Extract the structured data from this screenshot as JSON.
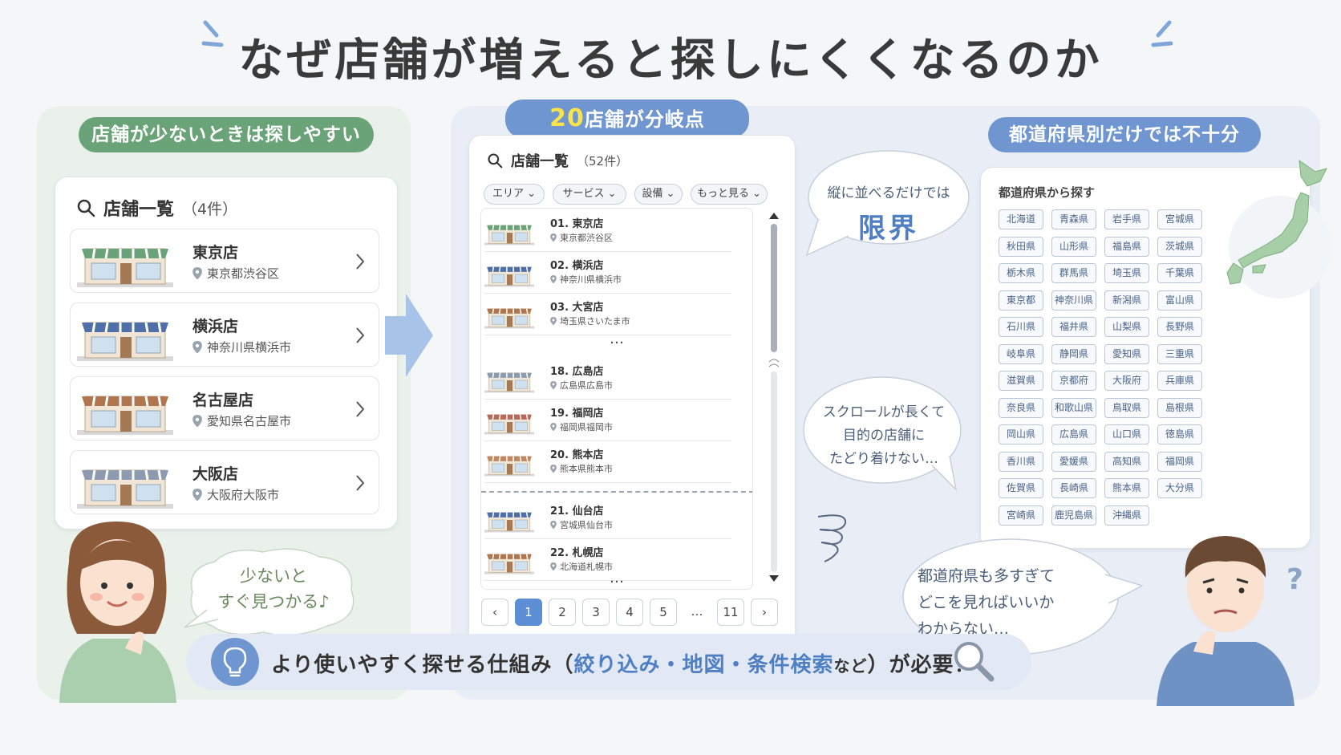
{
  "title": "なぜ店舗が増えると探しにくくなるのか",
  "left": {
    "pill": "店舗が少ないときは探しやすい",
    "list_title": "店舗一覧",
    "list_count": "（4件）",
    "stores": [
      {
        "name": "東京店",
        "addr": "東京都渋谷区"
      },
      {
        "name": "横浜店",
        "addr": "神奈川県横浜市"
      },
      {
        "name": "名古屋店",
        "addr": "愛知県名古屋市"
      },
      {
        "name": "大阪店",
        "addr": "大阪府大阪市"
      }
    ],
    "bubble_line1": "少ないと",
    "bubble_line2": "すぐ見つかる♪"
  },
  "middle": {
    "pill_num": "20",
    "pill_text": "店舗が分岐点",
    "list_title": "店舗一覧",
    "list_count": "（52件）",
    "filters": [
      "エリア",
      "サービス",
      "設備",
      "もっと見る"
    ],
    "items_a": [
      {
        "name": "01. 東京店",
        "addr": "東京都渋谷区"
      },
      {
        "name": "02. 横浜店",
        "addr": "神奈川県横浜市"
      },
      {
        "name": "03. 大宮店",
        "addr": "埼玉県さいたま市"
      }
    ],
    "items_b": [
      {
        "name": "18. 広島店",
        "addr": "広島県広島市"
      },
      {
        "name": "19. 福岡店",
        "addr": "福岡県福岡市"
      },
      {
        "name": "20. 熊本店",
        "addr": "熊本県熊本市"
      }
    ],
    "items_c": [
      {
        "name": "21. 仙台店",
        "addr": "宮城県仙台市"
      },
      {
        "name": "22. 札幌店",
        "addr": "北海道札幌市"
      }
    ],
    "ellipsis": "…",
    "pages": [
      "1",
      "2",
      "3",
      "4",
      "5",
      "…",
      "11"
    ],
    "prev": "‹",
    "next": "›"
  },
  "bubbles": {
    "limit_line1": "縦に並べるだけでは",
    "limit_line2": "限界",
    "scroll_line1": "スクロールが長くて",
    "scroll_line2": "目的の店舗に",
    "scroll_line3": "たどり着けない…",
    "pref_line1": "都道府県も多すぎて",
    "pref_line2": "どこを見ればいいか",
    "pref_line3": "わからない…"
  },
  "right": {
    "pill": "都道府県別だけでは不十分",
    "card_title": "都道府県から探す",
    "prefs": [
      "北海道",
      "青森県",
      "岩手県",
      "宮城県",
      "秋田県",
      "山形県",
      "福島県",
      "茨城県",
      "栃木県",
      "群馬県",
      "埼玉県",
      "千葉県",
      "東京都",
      "神奈川県",
      "新潟県",
      "富山県",
      "石川県",
      "福井県",
      "山梨県",
      "長野県",
      "岐阜県",
      "静岡県",
      "愛知県",
      "三重県",
      "滋賀県",
      "京都府",
      "大阪府",
      "兵庫県",
      "奈良県",
      "和歌山県",
      "鳥取県",
      "島根県",
      "岡山県",
      "広島県",
      "山口県",
      "徳島県",
      "香川県",
      "愛媛県",
      "高知県",
      "福岡県",
      "佐賀県",
      "長崎県",
      "熊本県",
      "大分県",
      "宮崎県",
      "鹿児島県",
      "沖縄県"
    ]
  },
  "banner": {
    "part1": "より使いやすく探せる仕組み（",
    "hl1": "絞り込み・地図・条件検索",
    "small": "など",
    "part2": "）が必要！"
  },
  "colors": {
    "green": "#6aa377",
    "blue": "#6f96d0",
    "accent": "#5b8ed4",
    "highlight": "#4f7fc3"
  }
}
